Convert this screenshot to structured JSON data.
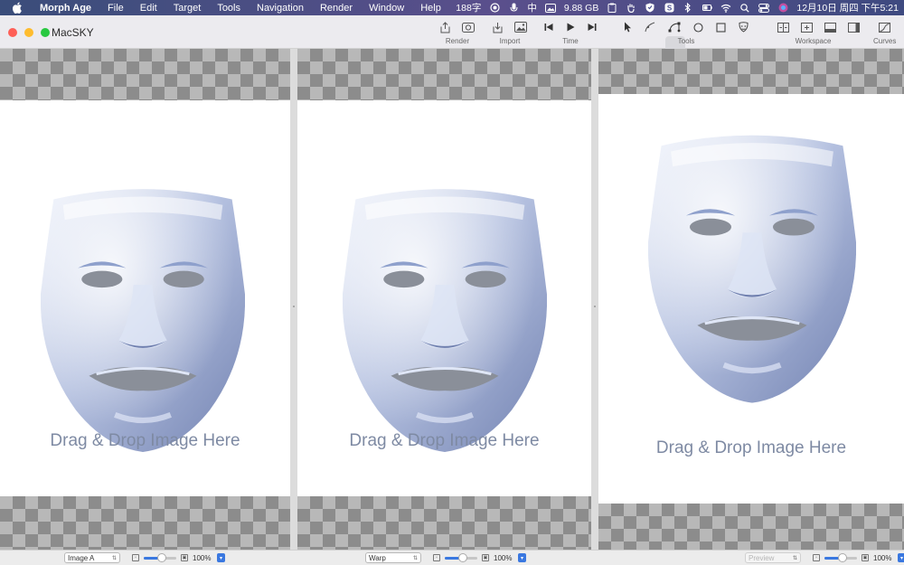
{
  "menubar": {
    "apple_icon": "apple-logo-icon",
    "items": [
      "Morph Age",
      "File",
      "Edit",
      "Target",
      "Tools",
      "Navigation",
      "Render",
      "Window",
      "Help"
    ],
    "status": {
      "word_count": "188字",
      "input_method": "中",
      "memory": "9.88 GB",
      "datetime": "12月10日 周四 下午5:21"
    }
  },
  "window": {
    "title": "MacSKY",
    "toolbar": {
      "render_label": "Render",
      "import_label": "Import",
      "time_label": "Time",
      "tools_label": "Tools",
      "workspace_label": "Workspace",
      "curves_label": "Curves"
    }
  },
  "panels": [
    {
      "name": "image-a",
      "drop_text": "Drag & Drop Image Here",
      "popup": "Image A",
      "zoom": "100%",
      "zoom_level": 0.55
    },
    {
      "name": "warp",
      "drop_text": "Drag & Drop Image Here",
      "popup": "Warp",
      "zoom": "100%",
      "zoom_level": 0.55
    },
    {
      "name": "image-b",
      "drop_text": "Drag & Drop Image Here",
      "popup": "Preview",
      "zoom": "100%",
      "zoom_level": 0.55
    }
  ],
  "colors": {
    "selection": "#3a78e0",
    "drop_text": "#7e8aa3",
    "face_light": "#e4eaf7",
    "face_mid": "#a9b6d8",
    "face_dark": "#6f7fae"
  }
}
